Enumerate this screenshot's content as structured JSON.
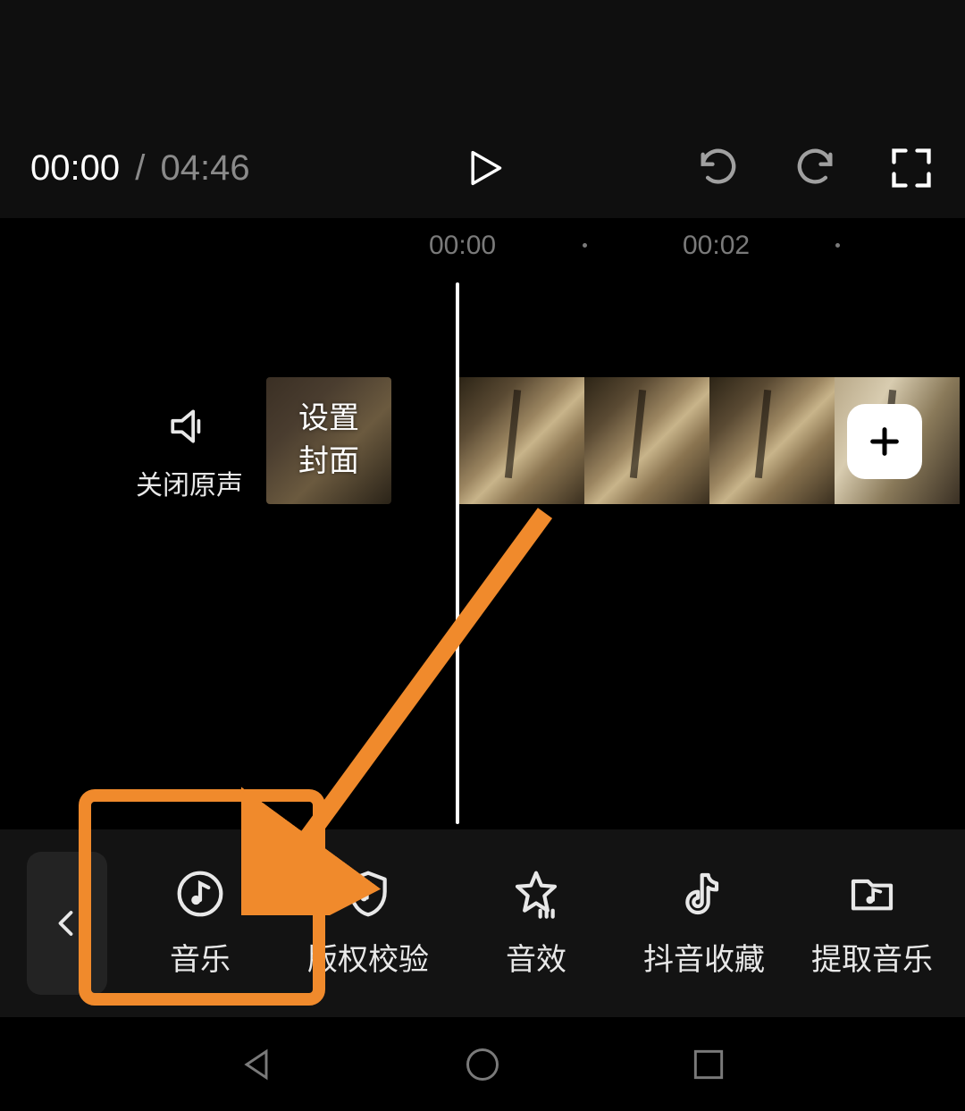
{
  "player": {
    "current_time": "00:00",
    "separator": "/",
    "total_time": "04:46"
  },
  "ruler": {
    "ticks": [
      "00:00",
      "00:02"
    ]
  },
  "audio": {
    "mute_label": "关闭原声"
  },
  "cover": {
    "label": "设置\n封面"
  },
  "toolbar": {
    "items": [
      {
        "key": "music",
        "label": "音乐"
      },
      {
        "key": "copyright",
        "label": "版权校验"
      },
      {
        "key": "sfx",
        "label": "音效"
      },
      {
        "key": "douyin_fav",
        "label": "抖音收藏"
      },
      {
        "key": "extract",
        "label": "提取音乐"
      }
    ]
  },
  "annotation": {
    "color": "#f08a2c"
  }
}
